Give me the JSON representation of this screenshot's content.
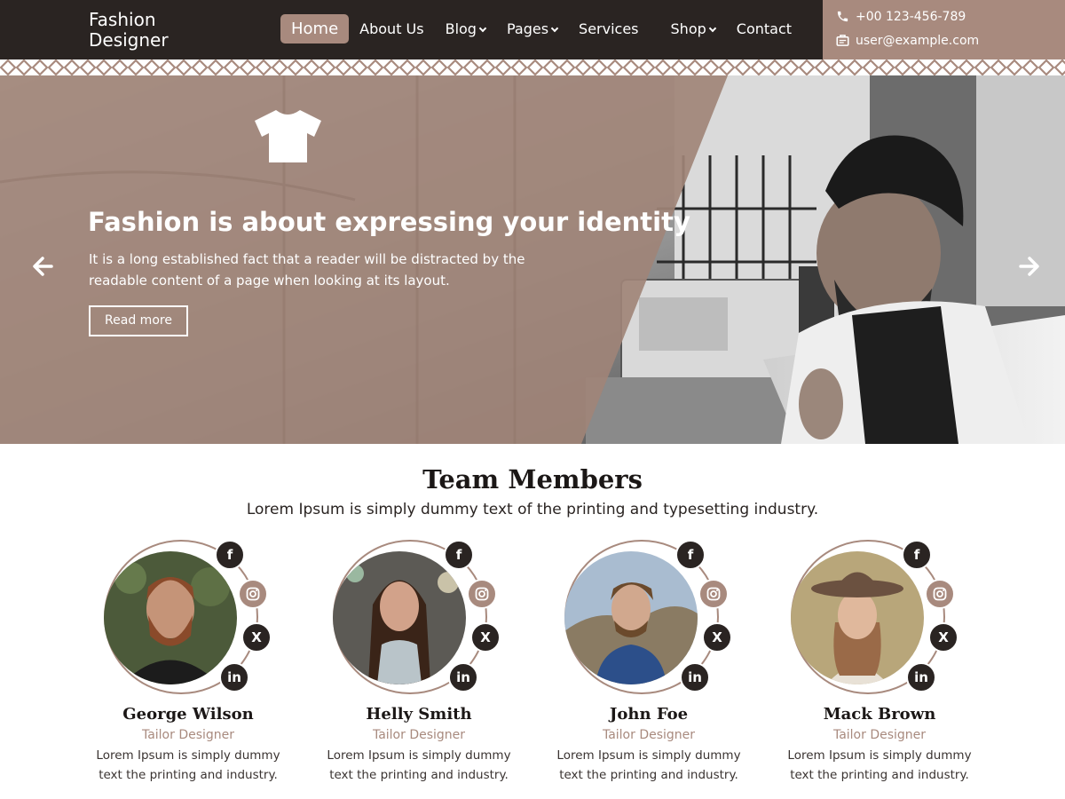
{
  "header": {
    "logo_line1": "Fashion",
    "logo_line2": "Designer",
    "nav": [
      {
        "label": "Home",
        "active": true,
        "dropdown": false
      },
      {
        "label": "About Us",
        "active": false,
        "dropdown": false
      },
      {
        "label": "Blog",
        "active": false,
        "dropdown": true
      },
      {
        "label": "Pages",
        "active": false,
        "dropdown": true
      },
      {
        "label": "Services",
        "active": false,
        "dropdown": false
      },
      {
        "label": "Shop",
        "active": false,
        "dropdown": true
      },
      {
        "label": "Contact",
        "active": false,
        "dropdown": false
      }
    ],
    "phone": "+00 123-456-789",
    "email": "user@example.com"
  },
  "hero": {
    "title": "Fashion is about expressing your identity",
    "text": "It is a long established fact that a reader will be distracted by the readable content of a page when looking at its layout.",
    "button": "Read more",
    "icon": "tshirt-icon"
  },
  "team": {
    "title": "Team Members",
    "subtitle": "Lorem Ipsum is simply dummy text of the printing and typesetting industry.",
    "members": [
      {
        "name": "George Wilson",
        "role": "Tailor Designer",
        "desc": "Lorem Ipsum is simply dummy text the printing and industry."
      },
      {
        "name": "Helly Smith",
        "role": "Tailor Designer",
        "desc": "Lorem Ipsum is simply dummy text the printing and industry."
      },
      {
        "name": "John Foe",
        "role": "Tailor Designer",
        "desc": "Lorem Ipsum is simply dummy text the printing and industry."
      },
      {
        "name": "Mack Brown",
        "role": "Tailor Designer",
        "desc": "Lorem Ipsum is simply dummy text the printing and industry."
      }
    ],
    "social_icons": [
      "facebook-icon",
      "instagram-icon",
      "x-icon",
      "linkedin-icon"
    ]
  },
  "colors": {
    "dark": "#2a2422",
    "accent": "#a88a7e",
    "text": "#1b1716"
  }
}
